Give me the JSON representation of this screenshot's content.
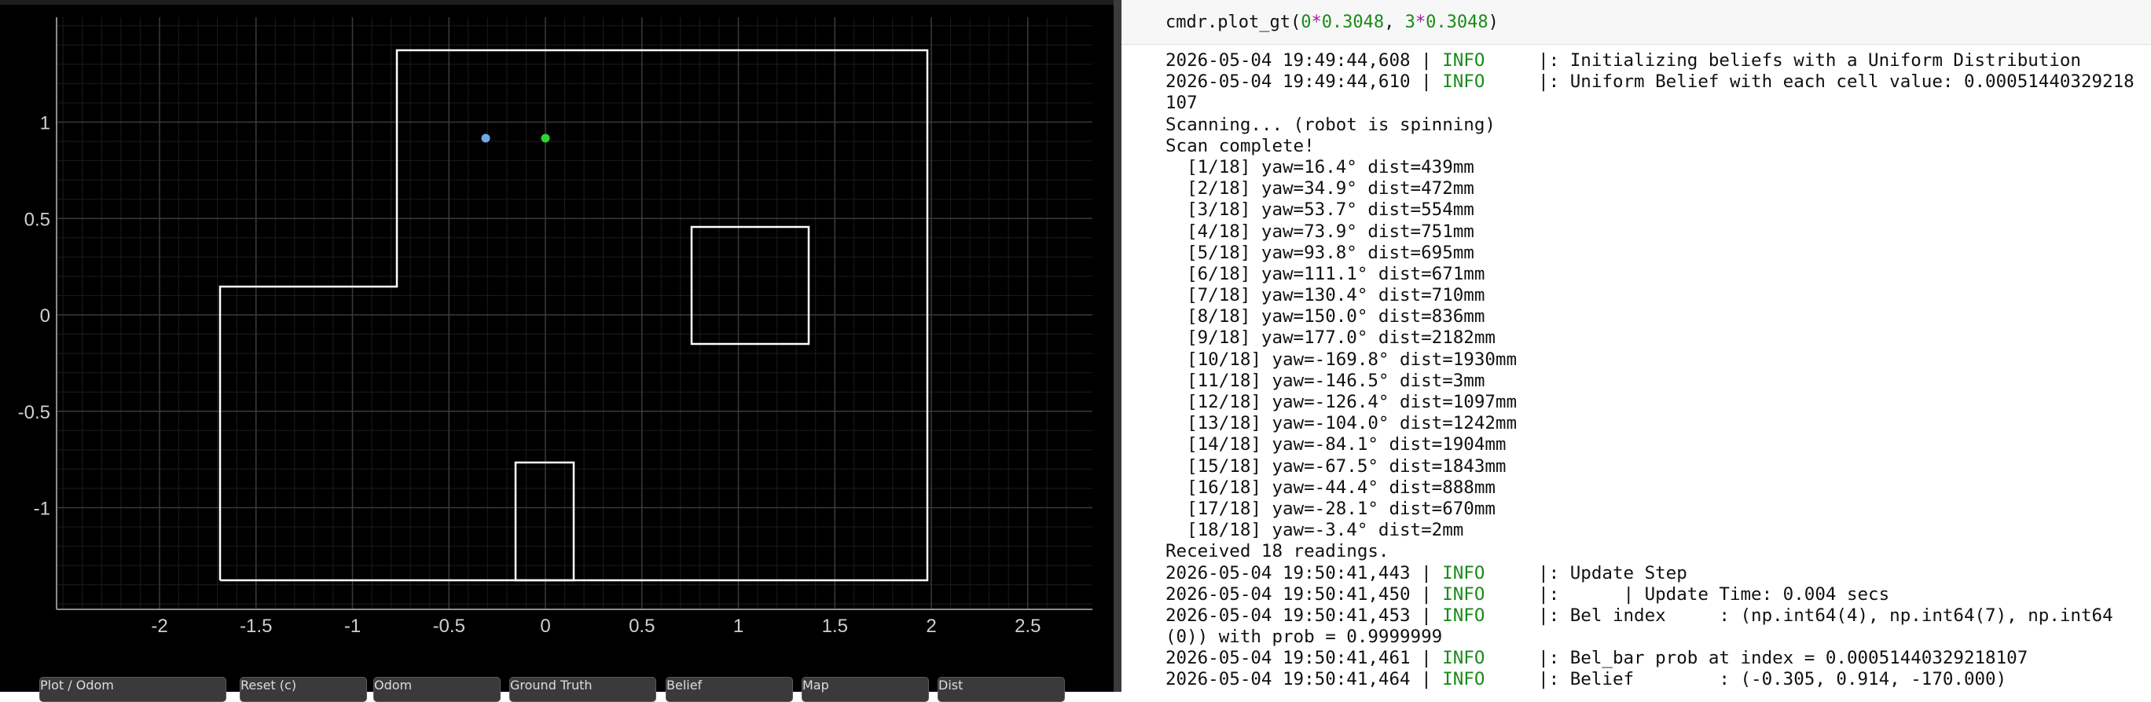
{
  "plot": {
    "x_ticks": [
      "-2",
      "-1.5",
      "-1",
      "-0.5",
      "0",
      "0.5",
      "1",
      "1.5",
      "2",
      "2.5"
    ],
    "y_ticks": [
      "1",
      "0.5",
      "0",
      "-0.5",
      "-1"
    ],
    "colors": {
      "background": "#000000",
      "map_lines": "#ffffff",
      "grid": "#3a3a3a",
      "belief_point": "#6ea8e6",
      "ground_truth_point": "#2fd32f"
    }
  },
  "buttons": [
    "Plot / Odom",
    "Reset (c)",
    "Odom",
    "Ground Truth",
    "Belief",
    "Map",
    "Dist"
  ],
  "code": {
    "fn": "cmdr.plot_gt(",
    "a": "0",
    "op1": "*",
    "b": "0.3048",
    "sep": ", ",
    "c": "3",
    "op2": "*",
    "d": "0.3048",
    "close": ")"
  },
  "output_lines": [
    {
      "t": "2026-05-04 19:49:44,608 | ",
      "lvl": "INFO",
      "m": "     |: Initializing beliefs with a Uniform Distribution"
    },
    {
      "t": "2026-05-04 19:49:44,610 | ",
      "lvl": "INFO",
      "m": "     |: Uniform Belief with each cell value: 0.00051440329218"
    },
    {
      "t": "107"
    },
    {
      "t": "Scanning... (robot is spinning)"
    },
    {
      "t": "Scan complete!"
    },
    {
      "t": "  [1/18] yaw=16.4° dist=439mm"
    },
    {
      "t": "  [2/18] yaw=34.9° dist=472mm"
    },
    {
      "t": "  [3/18] yaw=53.7° dist=554mm"
    },
    {
      "t": "  [4/18] yaw=73.9° dist=751mm"
    },
    {
      "t": "  [5/18] yaw=93.8° dist=695mm"
    },
    {
      "t": "  [6/18] yaw=111.1° dist=671mm"
    },
    {
      "t": "  [7/18] yaw=130.4° dist=710mm"
    },
    {
      "t": "  [8/18] yaw=150.0° dist=836mm"
    },
    {
      "t": "  [9/18] yaw=177.0° dist=2182mm"
    },
    {
      "t": "  [10/18] yaw=-169.8° dist=1930mm"
    },
    {
      "t": "  [11/18] yaw=-146.5° dist=3mm"
    },
    {
      "t": "  [12/18] yaw=-126.4° dist=1097mm"
    },
    {
      "t": "  [13/18] yaw=-104.0° dist=1242mm"
    },
    {
      "t": "  [14/18] yaw=-84.1° dist=1904mm"
    },
    {
      "t": "  [15/18] yaw=-67.5° dist=1843mm"
    },
    {
      "t": "  [16/18] yaw=-44.4° dist=888mm"
    },
    {
      "t": "  [17/18] yaw=-28.1° dist=670mm"
    },
    {
      "t": "  [18/18] yaw=-3.4° dist=2mm"
    },
    {
      "t": "Received 18 readings."
    },
    {
      "t": "2026-05-04 19:50:41,443 | ",
      "lvl": "INFO",
      "m": "     |: Update Step"
    },
    {
      "t": "2026-05-04 19:50:41,450 | ",
      "lvl": "INFO",
      "m": "     |:      | Update Time: 0.004 secs"
    },
    {
      "t": "2026-05-04 19:50:41,453 | ",
      "lvl": "INFO",
      "m": "     |: Bel index     : (np.int64(4), np.int64(7), np.int64"
    },
    {
      "t": "(0)) with prob = 0.9999999"
    },
    {
      "t": "2026-05-04 19:50:41,461 | ",
      "lvl": "INFO",
      "m": "     |: Bel_bar prob at index = 0.00051440329218107"
    },
    {
      "t": "2026-05-04 19:50:41,464 | ",
      "lvl": "INFO",
      "m": "     |: Belief        : (-0.305, 0.914, -170.000)"
    }
  ]
}
